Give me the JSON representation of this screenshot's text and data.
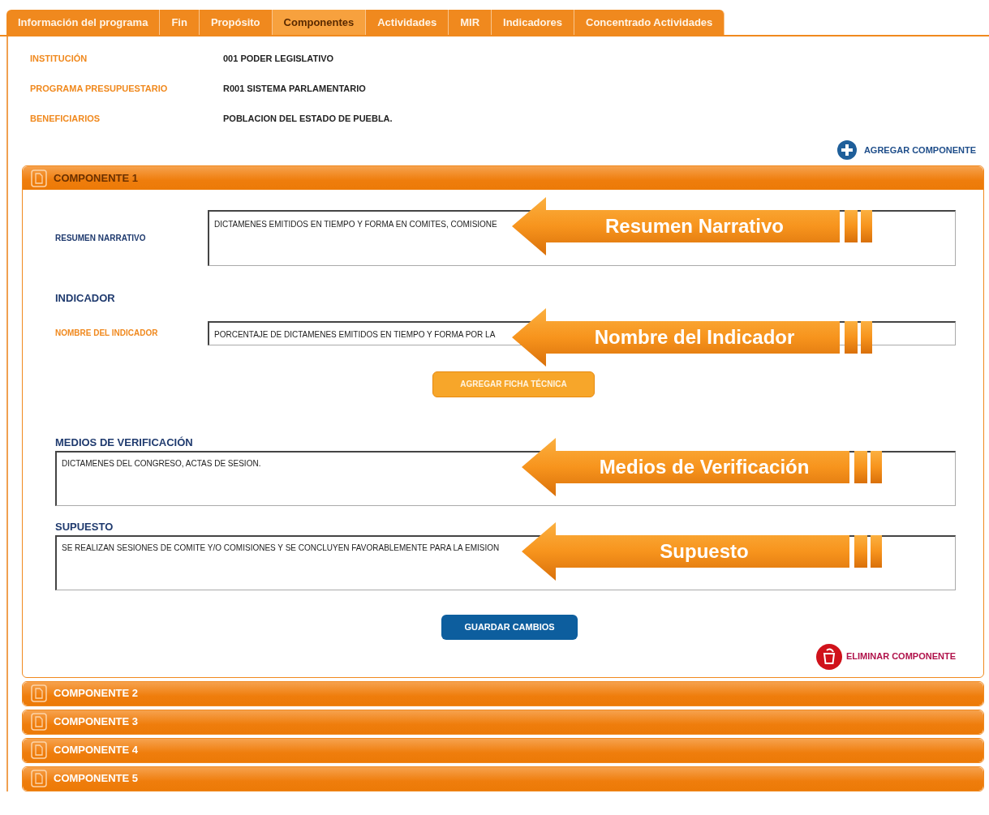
{
  "tabs": [
    {
      "label": "Información del programa",
      "selected": false
    },
    {
      "label": "Fin",
      "selected": false
    },
    {
      "label": "Propósito",
      "selected": false
    },
    {
      "label": "Componentes",
      "selected": true
    },
    {
      "label": "Actividades",
      "selected": false
    },
    {
      "label": "MIR",
      "selected": false
    },
    {
      "label": "Indicadores",
      "selected": false
    },
    {
      "label": "Concentrado Actividades",
      "selected": false
    }
  ],
  "info": [
    {
      "label": "INSTITUCIÓN",
      "value": "001 PODER LEGISLATIVO"
    },
    {
      "label": "PROGRAMA PRESUPUESTARIO",
      "value": "R001 SISTEMA PARLAMENTARIO"
    },
    {
      "label": "BENEFICIARIOS",
      "value": "POBLACION DEL ESTADO DE PUEBLA."
    }
  ],
  "add_link": "AGREGAR COMPONENTE",
  "components": [
    {
      "title": "COMPONENTE 1",
      "expanded": true
    },
    {
      "title": "COMPONENTE 2",
      "expanded": false
    },
    {
      "title": "COMPONENTE 3",
      "expanded": false
    },
    {
      "title": "COMPONENTE 4",
      "expanded": false
    },
    {
      "title": "COMPONENTE 5",
      "expanded": false
    }
  ],
  "form": {
    "items": [
      {
        "kind": "side_area",
        "label": "RESUMEN NARRATIVO",
        "value": "DICTAMENES EMITIDOS EN TIEMPO Y FORMA EN COMITES, COMISIONE",
        "callout": "Resumen Narrativo"
      },
      {
        "kind": "heading",
        "label": "INDICADOR"
      },
      {
        "kind": "side_line",
        "label": "NOMBRE DEL INDICADOR",
        "value": "PORCENTAJE DE DICTAMENES EMITIDOS EN TIEMPO Y FORMA POR LA",
        "callout": "Nombre del Indicador"
      },
      {
        "kind": "button",
        "label": "AGREGAR FICHA TÉCNICA"
      },
      {
        "kind": "top_area",
        "label": "MEDIOS DE VERIFICACIÓN",
        "value": "DICTAMENES DEL CONGRESO, ACTAS DE SESION.",
        "callout": "Medios de Verificación"
      },
      {
        "kind": "top_area",
        "label": "SUPUESTO",
        "value": "SE REALIZAN SESIONES DE COMITE Y/O COMISIONES Y SE CONCLUYEN FAVORABLEMENTE PARA LA EMISION",
        "callout": "Supuesto"
      }
    ],
    "save_button": "GUARDAR CAMBIOS",
    "delete_link": "ELIMINAR COMPONENTE"
  }
}
